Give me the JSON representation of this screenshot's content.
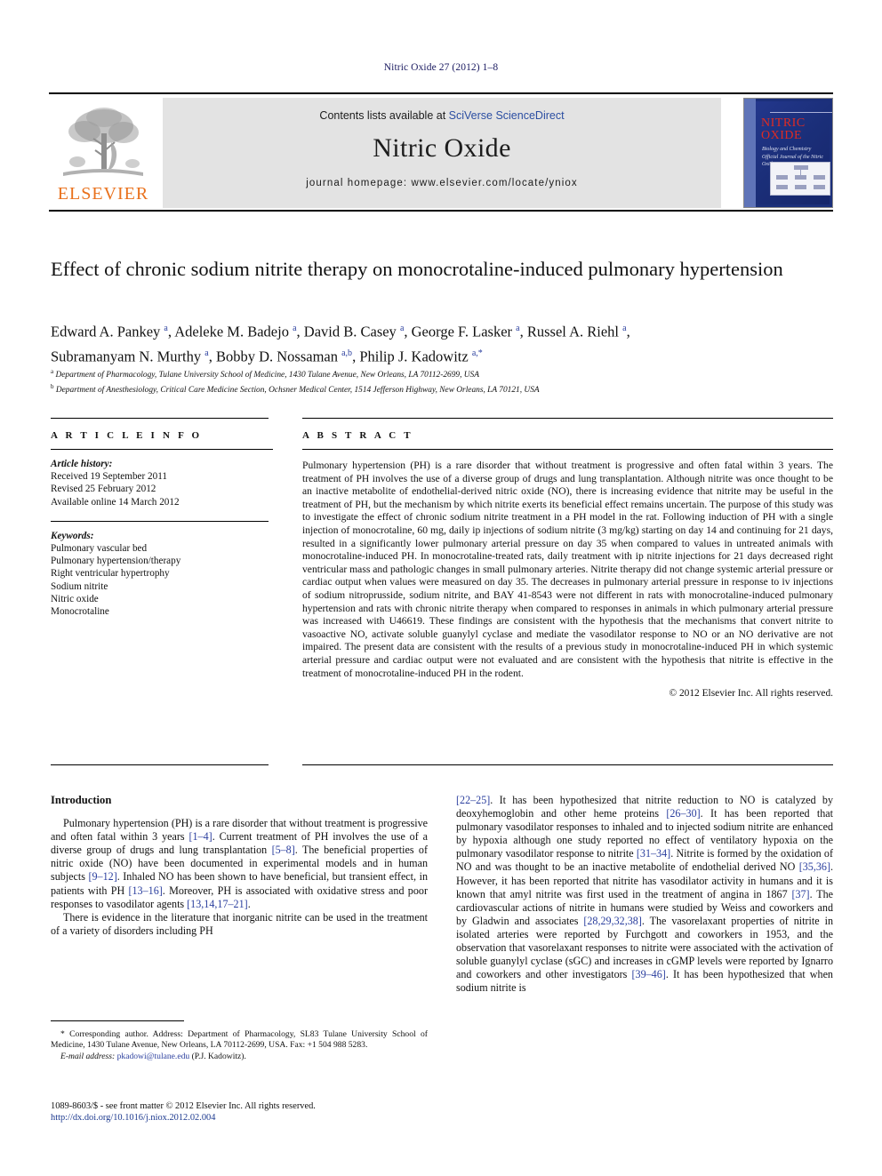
{
  "running_head": "Nitric Oxide 27 (2012) 1–8",
  "masthead": {
    "contents_prefix": "Contents lists available at ",
    "contents_link": "SciVerse ScienceDirect",
    "journal_name": "Nitric Oxide",
    "homepage": "journal homepage: www.elsevier.com/locate/yniox",
    "publisher_logo_text": "ELSEVIER",
    "cover": {
      "title_line1": "NITRIC",
      "title_line2": "OXIDE",
      "subtitle1": "Biology and Chemistry",
      "subtitle2": "Official Journal of the Nitric Oxide Society"
    }
  },
  "article": {
    "title": "Effect of chronic sodium nitrite therapy on monocrotaline-induced pulmonary hypertension",
    "authors_line1": "Edward A. Pankey <sup>a</sup>, Adeleke M. Badejo <sup>a</sup>, David B. Casey <sup>a</sup>, George F. Lasker <sup>a</sup>, Russel A. Riehl <sup>a</sup>,",
    "authors_line2": "Subramanyam N. Murthy <sup>a</sup>, Bobby D. Nossaman <sup>a,b</sup>, Philip J. Kadowitz <sup>a,*</sup>",
    "affiliation_a": "<sup>a</sup> Department of Pharmacology, Tulane University School of Medicine, 1430 Tulane Avenue, New Orleans, LA 70112-2699, USA",
    "affiliation_b": "<sup>b</sup> Department of Anesthesiology, Critical Care Medicine Section, Ochsner Medical Center, 1514 Jefferson Highway, New Orleans, LA 70121, USA"
  },
  "article_info": {
    "heading": "A R T I C L E   I N F O",
    "history_label": "Article history:",
    "received": "Received 19 September 2011",
    "revised": "Revised 25 February 2012",
    "available": "Available online 14 March 2012",
    "keywords_label": "Keywords:",
    "keywords": [
      "Pulmonary vascular bed",
      "Pulmonary hypertension/therapy",
      "Right ventricular hypertrophy",
      "Sodium nitrite",
      "Nitric oxide",
      "Monocrotaline"
    ]
  },
  "abstract": {
    "heading": "A B S T R A C T",
    "text": "Pulmonary hypertension (PH) is a rare disorder that without treatment is progressive and often fatal within 3 years. The treatment of PH involves the use of a diverse group of drugs and lung transplantation. Although nitrite was once thought to be an inactive metabolite of endothelial-derived nitric oxide (NO), there is increasing evidence that nitrite may be useful in the treatment of PH, but the mechanism by which nitrite exerts its beneficial effect remains uncertain. The purpose of this study was to investigate the effect of chronic sodium nitrite treatment in a PH model in the rat. Following induction of PH with a single injection of monocrotaline, 60 mg, daily ip injections of sodium nitrite (3 mg/kg) starting on day 14 and continuing for 21 days, resulted in a significantly lower pulmonary arterial pressure on day 35 when compared to values in untreated animals with monocrotaline-induced PH. In monocrotaline-treated rats, daily treatment with ip nitrite injections for 21 days decreased right ventricular mass and pathologic changes in small pulmonary arteries. Nitrite therapy did not change systemic arterial pressure or cardiac output when values were measured on day 35. The decreases in pulmonary arterial pressure in response to iv injections of sodium nitroprusside, sodium nitrite, and BAY 41-8543 were not different in rats with monocrotaline-induced pulmonary hypertension and rats with chronic nitrite therapy when compared to responses in animals in which pulmonary arterial pressure was increased with U46619. These findings are consistent with the hypothesis that the mechanisms that convert nitrite to vasoactive NO, activate soluble guanylyl cyclase and mediate the vasodilator response to NO or an NO derivative are not impaired. The present data are consistent with the results of a previous study in monocrotaline-induced PH in which systemic arterial pressure and cardiac output were not evaluated and are consistent with the hypothesis that nitrite is effective in the treatment of monocrotaline-induced PH in the rodent.",
    "copyright": "© 2012 Elsevier Inc. All rights reserved."
  },
  "introduction": {
    "heading": "Introduction",
    "left_para1": "Pulmonary hypertension (PH) is a rare disorder that without treatment is progressive and often fatal within 3 years <span class=\"ref\">[1–4]</span>. Current treatment of PH involves the use of a diverse group of drugs and lung transplantation <span class=\"ref\">[5–8]</span>. The beneficial properties of nitric oxide (NO) have been documented in experimental models and in human subjects <span class=\"ref\">[9–12]</span>. Inhaled NO has been shown to have beneficial, but transient effect, in patients with PH <span class=\"ref\">[13–16]</span>. Moreover, PH is associated with oxidative stress and poor responses to vasodilator agents <span class=\"ref\">[13,14,17–21]</span>.",
    "left_para2": "There is evidence in the literature that inorganic nitrite can be used in the treatment of a variety of disorders including PH",
    "right_para": "<span class=\"ref\">[22–25]</span>. It has been hypothesized that nitrite reduction to NO is catalyzed by deoxyhemoglobin and other heme proteins <span class=\"ref\">[26–30]</span>. It has been reported that pulmonary vasodilator responses to inhaled and to injected sodium nitrite are enhanced by hypoxia although one study reported no effect of ventilatory hypoxia on the pulmonary vasodilator response to nitrite <span class=\"ref\">[31–34]</span>. Nitrite is formed by the oxidation of NO and was thought to be an inactive metabolite of endothelial derived NO <span class=\"ref\">[35,36]</span>. However, it has been reported that nitrite has vasodilator activity in humans and it is known that amyl nitrite was first used in the treatment of angina in 1867 <span class=\"ref\">[37]</span>. The cardiovascular actions of nitrite in humans were studied by Weiss and coworkers and by Gladwin and associates <span class=\"ref\">[28,29,32,38]</span>. The vasorelaxant properties of nitrite in isolated arteries were reported by Furchgott and coworkers in 1953, and the observation that vasorelaxant responses to nitrite were associated with the activation of soluble guanylyl cyclase (sGC) and increases in cGMP levels were reported by Ignarro and coworkers and other investigators <span class=\"ref\">[39–46]</span>. It has been hypothesized that when sodium nitrite is"
  },
  "footnote": {
    "corresponding": "* Corresponding author. Address: Department of Pharmacology, SL83 Tulane University School of Medicine, 1430 Tulane Avenue, New Orleans, LA 70112-2699, USA. Fax: +1 504 988 5283.",
    "email_label": "E-mail address:",
    "email": "pkadowi@tulane.edu",
    "email_owner": "(P.J. Kadowitz)."
  },
  "footer": {
    "issn_line": "1089-8603/$ - see front matter © 2012 Elsevier Inc. All rights reserved.",
    "doi": "http://dx.doi.org/10.1016/j.niox.2012.02.004"
  }
}
